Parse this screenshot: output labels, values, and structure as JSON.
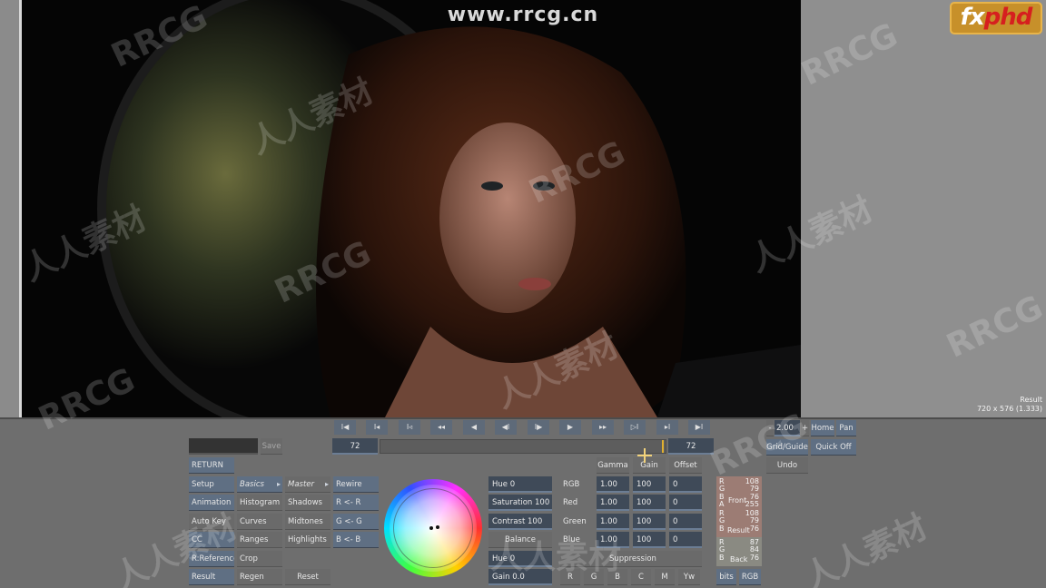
{
  "overlays": {
    "url": "www.rrcg.cn",
    "logo_fx": "fx",
    "logo_phd": "phd"
  },
  "viewer": {
    "result_label": "Result",
    "resolution": "720 x 576 (1.333)"
  },
  "transport": {
    "buttons": [
      "I◀",
      "I◂",
      "I◃",
      "◂◂",
      "◀",
      "◀I",
      "I▶",
      "▶",
      "▸▸",
      "▷I",
      "▸I",
      "▶I"
    ],
    "frame_start": "72",
    "frame_end": "72"
  },
  "zoom": {
    "minus": "-",
    "value": "2.00",
    "plus": "+",
    "home": "Home",
    "pan": "Pan",
    "grid_guide": "Grid/Guide",
    "quick_off": "Quick Off",
    "undo": "Undo"
  },
  "save": {
    "save_label": "Save",
    "name_value": ""
  },
  "menu": {
    "return": "RETURN",
    "col1": [
      "Setup",
      "Animation",
      "Auto Key",
      "CC",
      "R:Reference",
      "Result"
    ],
    "col2": [
      "Basics",
      "Histogram",
      "Curves",
      "Ranges",
      "Crop",
      "Regen"
    ],
    "col3": [
      "Master",
      "Shadows",
      "Midtones",
      "Highlights"
    ],
    "reset": "Reset",
    "col4": [
      "Rewire",
      "R <- R",
      "G <- G",
      "B <- B"
    ]
  },
  "params": {
    "hue": "Hue 0",
    "saturation": "Saturation 100",
    "contrast": "Contrast 100",
    "balance": "Balance",
    "hue2": "Hue 0",
    "gain": "Gain 0.0"
  },
  "channel_tabs": [
    "Gamma",
    "Gain",
    "Offset"
  ],
  "channels": [
    {
      "label": "RGB",
      "gamma": "1.00",
      "gain": "100",
      "offset": "0"
    },
    {
      "label": "Red",
      "gamma": "1.00",
      "gain": "100",
      "offset": "0"
    },
    {
      "label": "Green",
      "gamma": "1.00",
      "gain": "100",
      "offset": "0"
    },
    {
      "label": "Blue",
      "gamma": "1.00",
      "gain": "100",
      "offset": "0"
    }
  ],
  "suppression": {
    "label": "Suppression",
    "buttons": [
      "R",
      "G",
      "B",
      "C",
      "M",
      "Yw"
    ]
  },
  "meter": {
    "front_label": "Front",
    "result_label": "Result",
    "back_label": "Back",
    "letters": [
      "R",
      "G",
      "B",
      "A"
    ],
    "front_vals": [
      "108",
      "79",
      "76",
      "255"
    ],
    "result_vals": [
      "108",
      "79",
      "76"
    ],
    "back_letters": [
      "R",
      "G",
      "B"
    ],
    "back_vals": [
      "87",
      "84",
      "76"
    ],
    "bits": "bits",
    "rgb": "RGB"
  },
  "watermarks": [
    "RRCG",
    "人人素材"
  ]
}
